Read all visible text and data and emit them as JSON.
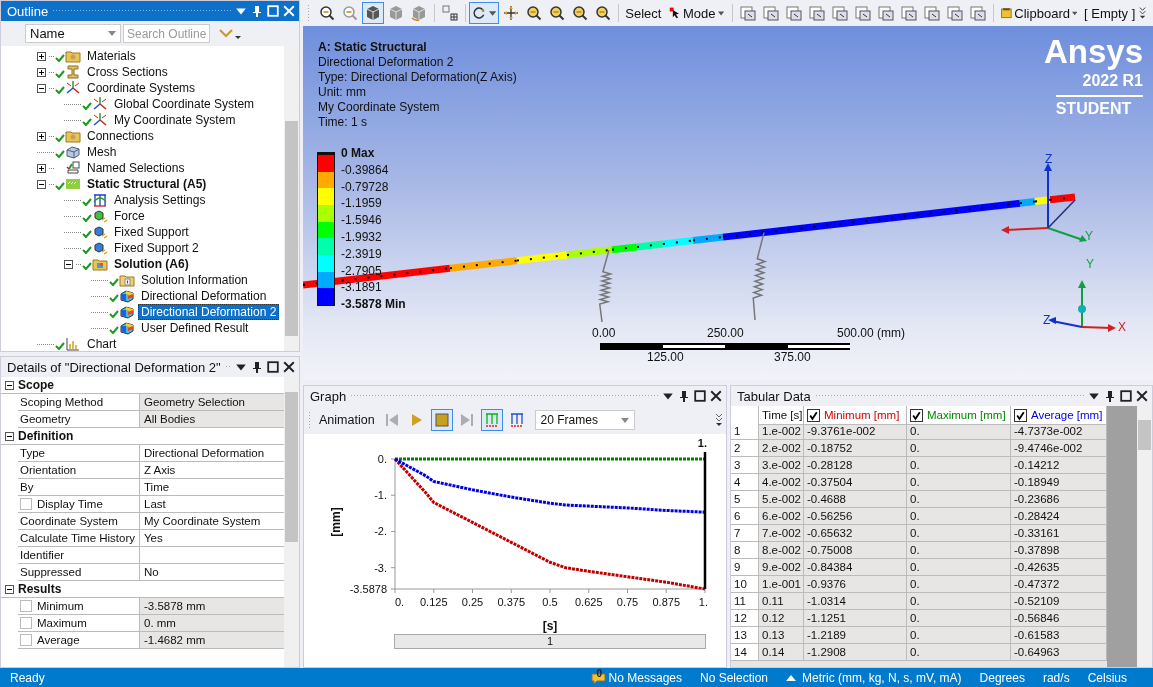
{
  "toolbar": {
    "groups": [
      [
        {
          "kind": "zoom-in",
          "selected": false
        },
        {
          "kind": "zoom-out",
          "selected": false
        },
        {
          "kind": "cube",
          "selected": true
        },
        {
          "kind": "cube-grey",
          "selected": false
        },
        {
          "kind": "cube-rotate",
          "selected": false
        }
      ],
      [
        {
          "kind": "grid",
          "selected": false
        }
      ],
      [
        {
          "kind": "rotate",
          "selected": true
        },
        {
          "kind": "pan",
          "selected": false
        },
        {
          "kind": "zoom",
          "selected": false
        },
        {
          "kind": "zoom",
          "selected": false
        },
        {
          "kind": "zoom",
          "selected": false
        },
        {
          "kind": "zoom",
          "selected": false
        }
      ],
      [
        {
          "kind": "text",
          "label": "Select",
          "selected": false
        },
        {
          "kind": "mode",
          "label": "Mode",
          "selected": false
        }
      ],
      [
        {
          "kind": "select-box",
          "selected": false
        },
        {
          "kind": "select-box",
          "selected": false
        },
        {
          "kind": "select-box",
          "selected": false
        },
        {
          "kind": "select-box",
          "selected": false
        },
        {
          "kind": "select-box",
          "selected": false
        },
        {
          "kind": "select-box",
          "selected": false
        },
        {
          "kind": "select-box",
          "selected": false
        },
        {
          "kind": "select-box",
          "selected": false
        },
        {
          "kind": "select-box",
          "selected": false
        },
        {
          "kind": "select-box",
          "selected": false
        },
        {
          "kind": "select-box",
          "selected": false
        }
      ],
      [
        {
          "kind": "clipboard",
          "label": "Clipboard",
          "selected": false
        },
        {
          "kind": "text",
          "label": "[ Empty ]",
          "selected": false
        }
      ]
    ]
  },
  "outline": {
    "title": "Outline",
    "filter": {
      "value": "Name"
    },
    "search": {
      "placeholder": "Search Outline"
    },
    "tree": [
      {
        "label": "Materials",
        "kind": "folder",
        "expanded": false,
        "done": true,
        "bold": false,
        "selected": false
      },
      {
        "label": "Cross Sections",
        "kind": "beam",
        "expanded": false,
        "done": true,
        "bold": false,
        "selected": false
      },
      {
        "label": "Coordinate Systems",
        "kind": "axes",
        "expanded": true,
        "done": true,
        "bold": false,
        "selected": false,
        "children": [
          {
            "label": "Global Coordinate System",
            "kind": "axes",
            "done": true,
            "bold": false,
            "selected": false
          },
          {
            "label": "My Coordinate System",
            "kind": "axes",
            "done": true,
            "bold": false,
            "selected": false
          }
        ]
      },
      {
        "label": "Connections",
        "kind": "folder",
        "expanded": false,
        "done": true,
        "bold": false,
        "selected": false
      },
      {
        "label": "Mesh",
        "kind": "mesh",
        "done": true,
        "bold": false,
        "selected": false
      },
      {
        "label": "Named Selections",
        "kind": "selection",
        "expanded": false,
        "done": false,
        "bold": false,
        "selected": false
      },
      {
        "label": "Static Structural (A5)",
        "kind": "analysis",
        "expanded": true,
        "done": true,
        "bold": true,
        "selected": false,
        "children": [
          {
            "label": "Analysis Settings",
            "kind": "settings",
            "done": true,
            "bold": false,
            "selected": false
          },
          {
            "label": "Force",
            "kind": "force",
            "done": true,
            "bold": false,
            "selected": false
          },
          {
            "label": "Fixed Support",
            "kind": "support",
            "done": true,
            "bold": false,
            "selected": false
          },
          {
            "label": "Fixed Support 2",
            "kind": "support",
            "done": true,
            "bold": false,
            "selected": false
          },
          {
            "label": "Solution (A6)",
            "kind": "solution",
            "expanded": true,
            "done": true,
            "bold": true,
            "selected": false,
            "children": [
              {
                "label": "Solution Information",
                "kind": "info",
                "done": true,
                "bold": false,
                "selected": false
              },
              {
                "label": "Directional Deformation",
                "kind": "result",
                "done": true,
                "bold": false,
                "selected": false
              },
              {
                "label": "Directional Deformation 2",
                "kind": "result",
                "done": true,
                "bold": false,
                "selected": true
              },
              {
                "label": "User Defined Result",
                "kind": "result",
                "done": true,
                "bold": false,
                "selected": false
              }
            ]
          }
        ]
      },
      {
        "label": "Chart",
        "kind": "chart",
        "done": true,
        "bold": false,
        "selected": false
      }
    ]
  },
  "details": {
    "title": "Details of \"Directional Deformation 2\"",
    "sections": [
      {
        "title": "Scope",
        "expanded": true,
        "rows": [
          {
            "label": "Scoping Method",
            "value": "Geometry Selection",
            "readonly": true,
            "kind": "plain"
          },
          {
            "label": "Geometry",
            "value": "All Bodies",
            "readonly": true,
            "kind": "plain"
          }
        ]
      },
      {
        "title": "Definition",
        "expanded": true,
        "rows": [
          {
            "label": "Type",
            "value": "Directional Deformation",
            "readonly": false,
            "kind": "plain"
          },
          {
            "label": "Orientation",
            "value": "Z Axis",
            "readonly": false,
            "kind": "plain"
          },
          {
            "label": "By",
            "value": "Time",
            "readonly": false,
            "kind": "plain"
          },
          {
            "label": "Display Time",
            "value": "Last",
            "readonly": false,
            "kind": "checkbox",
            "checked": false
          },
          {
            "label": "Coordinate System",
            "value": "My Coordinate System",
            "readonly": false,
            "kind": "plain"
          },
          {
            "label": "Calculate Time History",
            "value": "Yes",
            "readonly": false,
            "kind": "plain"
          },
          {
            "label": "Identifier",
            "readonly": false,
            "kind": "plain"
          },
          {
            "label": "Suppressed",
            "value": "No",
            "readonly": false,
            "kind": "plain"
          }
        ]
      },
      {
        "title": "Results",
        "expanded": true,
        "rows": [
          {
            "label": "Minimum",
            "value": "-3.5878 mm",
            "readonly": true,
            "kind": "checkbox",
            "checked": false
          },
          {
            "label": "Maximum",
            "value": "0. mm",
            "readonly": true,
            "kind": "checkbox",
            "checked": false
          },
          {
            "label": "Average",
            "value": "-1.4682 mm",
            "readonly": true,
            "kind": "checkbox",
            "checked": false
          }
        ]
      }
    ]
  },
  "viewport": {
    "info": {
      "title": "A: Static Structural",
      "lines": [
        "Directional Deformation 2",
        "Type: Directional Deformation(Z Axis)",
        "Unit: mm",
        "My Coordinate System",
        "Time: 1 s"
      ]
    },
    "legend": {
      "labels": [
        "0 Max",
        "-0.39864",
        "-0.79728",
        "-1.1959",
        "-1.5946",
        "-1.9932",
        "-2.3919",
        "-2.7905",
        "-3.1891",
        "-3.5878 Min"
      ],
      "bands": [
        {
          "color": "#ff0000"
        },
        {
          "color": "#ffaa00"
        },
        {
          "color": "#ffff00"
        },
        {
          "color": "#aaff00"
        },
        {
          "color": "#00ff00"
        },
        {
          "color": "#00ffaa"
        },
        {
          "color": "#00ffff"
        },
        {
          "color": "#00aaff"
        },
        {
          "color": "#0000ff"
        }
      ]
    },
    "logo": {
      "name": "Ansys",
      "version": "2022 R1",
      "edition": "STUDENT"
    },
    "scale": {
      "top_labels": [
        "0.00",
        "250.00",
        "500.00 (mm)"
      ],
      "bottom_labels": [
        "125.00",
        "375.00"
      ]
    },
    "triads": [
      {
        "labels": [
          {
            "kind": "z",
            "text": "Z"
          },
          {
            "kind": "y",
            "text": "Y"
          }
        ]
      },
      {
        "labels": [
          {
            "kind": "y",
            "text": "Y"
          },
          {
            "kind": "z",
            "text": "Z"
          },
          {
            "kind": "x",
            "text": "X"
          }
        ]
      }
    ]
  },
  "graph": {
    "title": "Graph",
    "animation": {
      "label": "Animation",
      "buttons": [
        {
          "kind": "first",
          "selected": false,
          "disabled": true
        },
        {
          "kind": "play",
          "selected": false,
          "disabled": false
        },
        {
          "kind": "stop",
          "selected": true,
          "disabled": false
        },
        {
          "kind": "last",
          "selected": false,
          "disabled": true
        },
        {
          "kind": "distributed",
          "selected": true,
          "disabled": false
        },
        {
          "kind": "result-sets",
          "selected": false,
          "disabled": false
        }
      ],
      "frames": {
        "value": "20 Frames"
      }
    },
    "chart_data": {
      "type": "line",
      "xlabel": "[s]",
      "ylabel": "[mm]",
      "x": [
        0,
        0.1,
        0.125,
        0.25,
        0.375,
        0.5,
        0.55,
        0.625,
        0.75,
        0.875,
        1
      ],
      "series": [
        {
          "color": "#c00000",
          "line_style": "dotted",
          "values": [
            0,
            -0.94,
            -1.2,
            -1.75,
            -2.3,
            -2.85,
            -3.0,
            -3.1,
            -3.25,
            -3.4,
            -3.5878
          ]
        },
        {
          "color": "#008000",
          "line_style": "dotted",
          "values": [
            0,
            0,
            0,
            0,
            0,
            0,
            0,
            0,
            0,
            0,
            0
          ]
        },
        {
          "color": "#0000e0",
          "line_style": "dotted",
          "values": [
            0,
            -0.47,
            -0.62,
            -0.85,
            -1.05,
            -1.22,
            -1.27,
            -1.3,
            -1.35,
            -1.42,
            -1.4682
          ]
        }
      ],
      "xlim": [
        0,
        1
      ],
      "ylim": [
        -3.5878,
        0
      ],
      "xticks": [
        {
          "value": 0,
          "label": "0."
        },
        0.125,
        0.25,
        0.375,
        0.5,
        0.625,
        0.75,
        0.875,
        {
          "value": 1,
          "label": "1."
        }
      ],
      "yticks": [
        {
          "value": 0,
          "label": "0."
        },
        {
          "value": -1,
          "label": "-1."
        },
        {
          "value": -2,
          "label": "-2."
        },
        {
          "value": -3,
          "label": "-3."
        },
        -3.5878
      ],
      "annotations": [
        "1."
      ]
    },
    "timeline": {
      "label": "1"
    }
  },
  "tabular": {
    "title": "Tabular Data",
    "columns": [
      {
        "label": "Time [s]",
        "kind": "plain"
      },
      {
        "label": "Minimum [mm]",
        "kind": "series",
        "checked": true,
        "color": "#d00000"
      },
      {
        "label": "Maximum [mm]",
        "kind": "series",
        "checked": true,
        "color": "#008800"
      },
      {
        "label": "Average [mm]",
        "kind": "series",
        "checked": true,
        "color": "#0000dd"
      }
    ],
    "rows": [
      {
        "index": "1",
        "cells": [
          "1.e-002",
          "-9.3761e-002",
          "0.",
          "-4.7373e-002"
        ]
      },
      {
        "index": "2",
        "cells": [
          "2.e-002",
          "-0.18752",
          "0.",
          "-9.4746e-002"
        ]
      },
      {
        "index": "3",
        "cells": [
          "3.e-002",
          "-0.28128",
          "0.",
          "-0.14212"
        ]
      },
      {
        "index": "4",
        "cells": [
          "4.e-002",
          "-0.37504",
          "0.",
          "-0.18949"
        ]
      },
      {
        "index": "5",
        "cells": [
          "5.e-002",
          "-0.4688",
          "0.",
          "-0.23686"
        ]
      },
      {
        "index": "6",
        "cells": [
          "6.e-002",
          "-0.56256",
          "0.",
          "-0.28424"
        ]
      },
      {
        "index": "7",
        "cells": [
          "7.e-002",
          "-0.65632",
          "0.",
          "-0.33161"
        ]
      },
      {
        "index": "8",
        "cells": [
          "8.e-002",
          "-0.75008",
          "0.",
          "-0.37898"
        ]
      },
      {
        "index": "9",
        "cells": [
          "9.e-002",
          "-0.84384",
          "0.",
          "-0.42635"
        ]
      },
      {
        "index": "10",
        "cells": [
          "1.e-001",
          "-0.9376",
          "0.",
          "-0.47372"
        ]
      },
      {
        "index": "11",
        "cells": [
          "0.11",
          "-1.0314",
          "0.",
          "-0.52109"
        ]
      },
      {
        "index": "12",
        "cells": [
          "0.12",
          "-1.1251",
          "0.",
          "-0.56846"
        ]
      },
      {
        "index": "13",
        "cells": [
          "0.13",
          "-1.2189",
          "0.",
          "-0.61583"
        ]
      },
      {
        "index": "14",
        "cells": [
          "0.14",
          "-1.2908",
          "0.",
          "-0.64963"
        ]
      }
    ]
  },
  "status_bar": {
    "state": "Ready",
    "messages": {
      "count": "0",
      "label": "No Messages"
    },
    "selection": "No Selection",
    "units": "Metric (mm, kg, N, s, mV, mA)",
    "angle": "Degrees",
    "rotation": "rad/s",
    "temperature": "Celsius"
  }
}
